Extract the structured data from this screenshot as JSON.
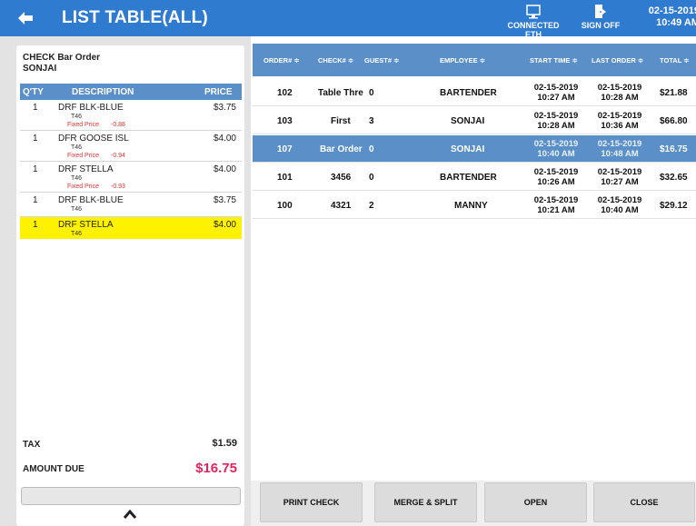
{
  "header": {
    "title": "LIST TABLE(ALL)",
    "eth_label": "CONNECTED ETH",
    "signoff_label": "SIGN OFF",
    "date": "02-15-2019",
    "time": "10:49 AM",
    "bg_color": "#2f7bd0"
  },
  "check": {
    "title": "CHECK Bar Order",
    "server": "SONJAI",
    "columns": {
      "qty": "Q'TY",
      "description": "DESCRIPTION",
      "price": "PRICE"
    },
    "items": [
      {
        "qty": "1",
        "description": "DRF BLK-BLUE",
        "sub": "T46",
        "fixed_label": "Fixed Price",
        "fixed_value": "-0.88",
        "price": "$3.75"
      },
      {
        "qty": "1",
        "description": "DFR GOOSE ISL",
        "sub": "T46",
        "fixed_label": "Fixed Price",
        "fixed_value": "-0.94",
        "price": "$4.00"
      },
      {
        "qty": "1",
        "description": "DRF STELLA",
        "sub": "T46",
        "fixed_label": "Fixed Price",
        "fixed_value": "-0.93",
        "price": "$4.00"
      },
      {
        "qty": "1",
        "description": "DRF BLK-BLUE",
        "sub": "T46",
        "price": "$3.75"
      },
      {
        "qty": "1",
        "description": "DRF STELLA",
        "sub": "T46",
        "price": "$4.00",
        "selected": true
      }
    ],
    "tax_label": "TAX",
    "tax_value": "$1.59",
    "due_label": "AMOUNT DUE",
    "due_value": "$16.75"
  },
  "orders": {
    "columns": {
      "order": "ORDER# ≑",
      "check": "CHECK# ≑",
      "guest": "GUEST# ≑",
      "employee": "EMPLOYEE ≑",
      "start": "START TIME ≑",
      "last": "LAST ORDER ≑",
      "total": "TOTAL ≑"
    },
    "rows": [
      {
        "order": "102",
        "check": "Table Thre",
        "guest": "0",
        "employee": "BARTENDER",
        "start_date": "02-15-2019",
        "start_time": "10:27 AM",
        "last_date": "02-15-2019",
        "last_time": "10:28 AM",
        "total": "$21.88"
      },
      {
        "order": "103",
        "check": "First",
        "guest": "3",
        "employee": "SONJAI",
        "start_date": "02-15-2019",
        "start_time": "10:28 AM",
        "last_date": "02-15-2019",
        "last_time": "10:36 AM",
        "total": "$66.80"
      },
      {
        "order": "107",
        "check": "Bar Order",
        "guest": "0",
        "employee": "SONJAI",
        "start_date": "02-15-2019",
        "start_time": "10:40 AM",
        "last_date": "02-15-2019",
        "last_time": "10:48 AM",
        "total": "$16.75",
        "selected": true
      },
      {
        "order": "101",
        "check": "3456",
        "guest": "0",
        "employee": "BARTENDER",
        "start_date": "02-15-2019",
        "start_time": "10:26 AM",
        "last_date": "02-15-2019",
        "last_time": "10:27 AM",
        "total": "$32.65"
      },
      {
        "order": "100",
        "check": "4321",
        "guest": "2",
        "employee": "MANNY",
        "start_date": "02-15-2019",
        "start_time": "10:21 AM",
        "last_date": "02-15-2019",
        "last_time": "10:40 AM",
        "total": "$29.12"
      }
    ]
  },
  "buttons": {
    "print": "PRINT CHECK",
    "merge": "MERGE & SPLIT",
    "open": "OPEN",
    "close": "CLOSE"
  }
}
